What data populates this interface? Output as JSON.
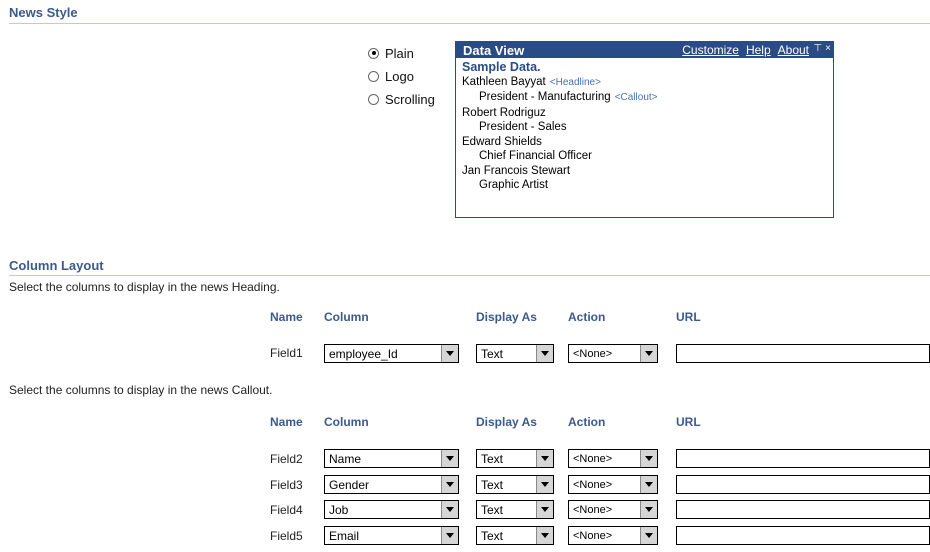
{
  "news_style": {
    "title": "News Style",
    "options": [
      {
        "label": "Plain",
        "checked": true
      },
      {
        "label": "Logo",
        "checked": false
      },
      {
        "label": "Scrolling",
        "checked": false
      }
    ]
  },
  "data_view": {
    "title": "Data View",
    "links": [
      "Customize",
      "Help",
      "About"
    ],
    "controls": [
      "pin-icon",
      "close-icon"
    ],
    "sample_label": "Sample Data.",
    "lines": [
      {
        "text": "Kathleen Bayyat",
        "tag": "<Headline>",
        "indent": false
      },
      {
        "text": "President - Manufacturing",
        "tag": "<Callout>",
        "indent": true
      },
      {
        "text": "Robert Rodriguz",
        "tag": "",
        "indent": false
      },
      {
        "text": "President - Sales",
        "tag": "",
        "indent": true
      },
      {
        "text": "Edward Shields",
        "tag": "",
        "indent": false
      },
      {
        "text": "Chief Financial Officer",
        "tag": "",
        "indent": true
      },
      {
        "text": "Jan Francois Stewart",
        "tag": "",
        "indent": false
      },
      {
        "text": "Graphic Artist",
        "tag": "",
        "indent": true
      }
    ]
  },
  "column_layout": {
    "title": "Column Layout",
    "heading_desc": "Select the columns to display in the news Heading.",
    "callout_desc": "Select the columns to display in the news Callout.",
    "headers": {
      "name": "Name",
      "column": "Column",
      "display_as": "Display As",
      "action": "Action",
      "url": "URL"
    },
    "heading_rows": [
      {
        "name": "Field1",
        "column": "employee_Id",
        "display_as": "Text",
        "action": "<None>",
        "url": ""
      }
    ],
    "callout_rows": [
      {
        "name": "Field2",
        "column": "Name",
        "display_as": "Text",
        "action": "<None>",
        "url": ""
      },
      {
        "name": "Field3",
        "column": "Gender",
        "display_as": "Text",
        "action": "<None>",
        "url": ""
      },
      {
        "name": "Field4",
        "column": "Job",
        "display_as": "Text",
        "action": "<None>",
        "url": ""
      },
      {
        "name": "Field5",
        "column": "Email",
        "display_as": "Text",
        "action": "<None>",
        "url": ""
      }
    ]
  }
}
